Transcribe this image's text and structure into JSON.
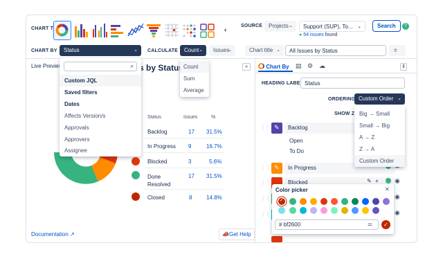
{
  "chart_type_label": "CHART TYPE",
  "source": {
    "label": "SOURCE",
    "select": "Projects",
    "project": "Support (SUP), To...",
    "found_count": "54 issues",
    "found_suffix": "found",
    "search_button": "Search"
  },
  "chart_by": {
    "label": "CHART BY",
    "value": "Status"
  },
  "calculate": {
    "label": "CALCULATE",
    "value": "Count",
    "field": "Issues"
  },
  "chart_title_select": "Chart title",
  "chart_title_value": "All Issues by Status",
  "live_preview": "Live Preview",
  "heading_partial": "s by Status",
  "chart_by_menu": [
    "Custom JQL",
    "Saved filters",
    "Dates",
    "Affects Version/s",
    "Approvals",
    "Approvers",
    "Assignee"
  ],
  "calc_menu": [
    "Count",
    "Sum",
    "Average"
  ],
  "table": {
    "headers": [
      "Status",
      "Issues",
      "%"
    ],
    "rows": [
      {
        "status": "Backlog",
        "issues": "17",
        "pct": "31.5%",
        "color": "#5243aa"
      },
      {
        "status": "In Progress",
        "issues": "9",
        "pct": "16.7%",
        "color": "#ff8b00"
      },
      {
        "status": "Blocked",
        "issues": "3",
        "pct": "5.6%",
        "color": "#de350b"
      },
      {
        "status": "Done Resolved",
        "issues": "17",
        "pct": "31.5%",
        "color": "#36b37e"
      },
      {
        "status": "Closed",
        "issues": "8",
        "pct": "14.8%",
        "color": "#bf2600"
      }
    ]
  },
  "documentation": "Documentation",
  "get_help": "Get Help",
  "right_panel": {
    "tab_chart_by": "Chart By",
    "heading_label": "HEADING LABEL",
    "heading_value": "Status",
    "ordering_label": "ORDERING",
    "ordering_value": "Custom Order",
    "show_z": "SHOW ZE",
    "ordering_menu": [
      "Big → Small",
      "Small → Big",
      "A → Z",
      "Z → A",
      "Custom Order"
    ],
    "items": [
      "Backlog",
      "In Progress",
      "Blocked"
    ],
    "backlog_sub": [
      "Open",
      "To Do"
    ],
    "color_picker_title": "Color picker",
    "hex_value": "# bf2600",
    "brand_colors": {
      "accent": "#0052cc",
      "selected": "#bf2600"
    }
  }
}
